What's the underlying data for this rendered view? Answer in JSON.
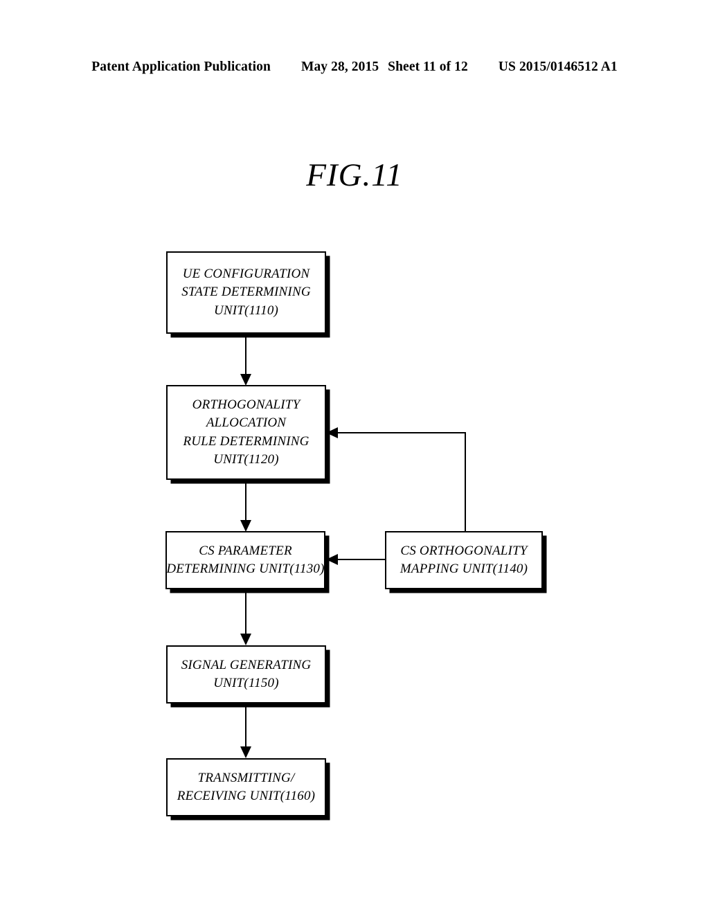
{
  "header": {
    "publication": "Patent Application Publication",
    "date": "May 28, 2015",
    "sheet": "Sheet 11 of 12",
    "patent_number": "US 2015/0146512 A1"
  },
  "figure": {
    "title": "FIG.11"
  },
  "diagram": {
    "type": "flowchart",
    "nodes": [
      {
        "id": "1110",
        "lines": [
          "UE CONFIGURATION",
          "STATE DETERMINING",
          "UNIT(1110)"
        ]
      },
      {
        "id": "1120",
        "lines": [
          "ORTHOGONALITY",
          "ALLOCATION",
          "RULE DETERMINING",
          "UNIT(1120)"
        ]
      },
      {
        "id": "1130",
        "lines": [
          "CS PARAMETER",
          "DETERMINING UNIT(1130)"
        ]
      },
      {
        "id": "1140",
        "lines": [
          "CS ORTHOGONALITY",
          "MAPPING UNIT(1140)"
        ]
      },
      {
        "id": "1150",
        "lines": [
          "SIGNAL GENERATING",
          "UNIT(1150)"
        ]
      },
      {
        "id": "1160",
        "lines": [
          "TRANSMITTING/",
          "RECEIVING UNIT(1160)"
        ]
      }
    ],
    "edges": [
      {
        "from": "1110",
        "to": "1120",
        "direction": "down"
      },
      {
        "from": "1120",
        "to": "1130",
        "direction": "down"
      },
      {
        "from": "1130",
        "to": "1150",
        "direction": "down"
      },
      {
        "from": "1150",
        "to": "1160",
        "direction": "down"
      },
      {
        "from": "1140",
        "to": "1130",
        "direction": "left"
      },
      {
        "from": "1140",
        "to": "1120",
        "direction": "up-then-left"
      }
    ]
  },
  "colors": {
    "ink": "#000000",
    "page": "#ffffff"
  }
}
